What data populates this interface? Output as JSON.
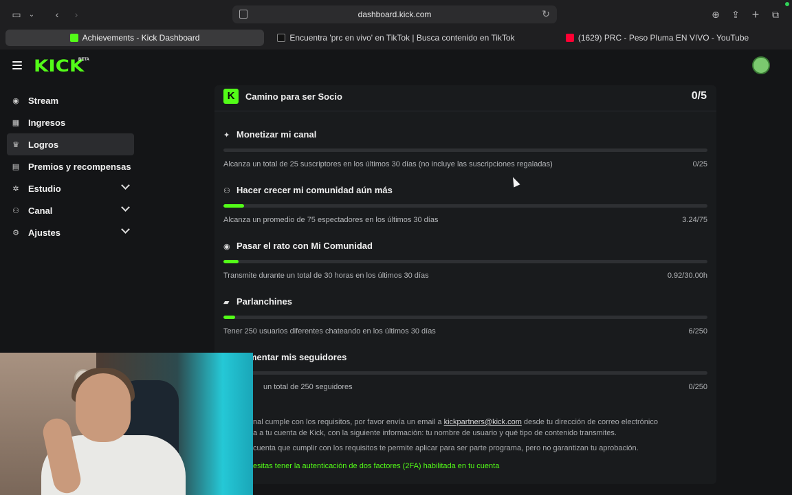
{
  "browser": {
    "url": "dashboard.kick.com",
    "tabs": [
      {
        "label": "Achievements - Kick Dashboard",
        "active": true,
        "favicon": "kick-favicon"
      },
      {
        "label": "Encuentra 'prc en vivo' en TikTok | Busca contenido en TikTok",
        "active": false,
        "favicon": "tiktok-favicon"
      },
      {
        "label": "(1629) PRC - Peso Pluma EN VIVO - YouTube",
        "active": false,
        "favicon": "youtube-favicon"
      }
    ]
  },
  "app": {
    "logo": "KICK",
    "beta": "BETA",
    "accent": "#53fc18"
  },
  "sidebar": {
    "items": [
      {
        "label": "Stream",
        "icon": "broadcast-icon"
      },
      {
        "label": "Ingresos",
        "icon": "chart-icon"
      },
      {
        "label": "Logros",
        "icon": "trophy-icon",
        "active": true
      },
      {
        "label": "Premios y recompensas",
        "icon": "gift-icon"
      },
      {
        "label": "Estudio",
        "icon": "sliders-icon",
        "expandable": true
      },
      {
        "label": "Canal",
        "icon": "users-icon",
        "expandable": true
      },
      {
        "label": "Ajustes",
        "icon": "gear-icon",
        "expandable": true
      }
    ]
  },
  "panel": {
    "title": "Camino para ser Socio",
    "count": "0/5",
    "goals": [
      {
        "title": "Monetizar mi canal",
        "icon": "sparkle-icon",
        "desc": "Alcanza un total de 25 suscriptores en los últimos 30 días (no incluye las suscripciones regaladas)",
        "value": "0/25",
        "progress": 0
      },
      {
        "title": "Hacer crecer mi comunidad aún más",
        "icon": "users-icon",
        "desc": "Alcanza un promedio de 75 espectadores en los últimos 30 días",
        "value": "3.24/75",
        "progress": 0.043
      },
      {
        "title": "Pasar el rato con Mi Comunidad",
        "icon": "broadcast-icon",
        "desc": "Transmite durante un total de 30 horas en los últimos 30 días",
        "value": "0.92/30.00h",
        "progress": 0.031
      },
      {
        "title": "Parlanchines",
        "icon": "chat-icon",
        "desc": "Tener 250 usuarios diferentes chateando en los últimos 30 días",
        "value": "6/250",
        "progress": 0.024
      },
      {
        "title": "mentar mis seguidores",
        "icon": "user-plus-icon",
        "desc": "un total de 250 seguidores",
        "value": "0/250",
        "progress": 0
      }
    ],
    "footer": {
      "line1_pre": "nal cumple con los requisitos, por favor envía un email a",
      "email": "kickpartners@kick.com",
      "line1_post": "desde tu dirección de correo electrónico",
      "line2": "a a tu cuenta de Kick, con la siguiente información: tu nombre de usuario y qué tipo de contenido transmites.",
      "line3": "cuenta que cumplir con los requisitos te permite aplicar para ser parte programa, pero no garantizan tu aprobación.",
      "line4": "esitas tener la autenticación de dos factores (2FA) habilitada en tu cuenta"
    }
  }
}
